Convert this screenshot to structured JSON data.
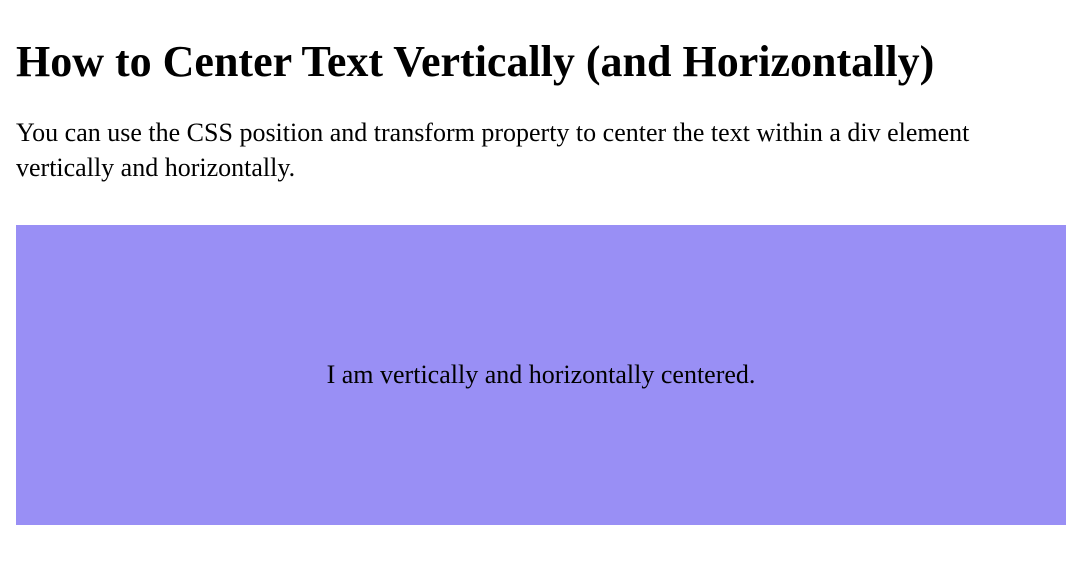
{
  "heading": "How to Center Text Vertically (and Horizontally)",
  "description": "You can use the CSS position and transform property to center the text within a div element vertically and horizontally.",
  "demo": {
    "centered_text": "I am vertically and horizontally centered."
  }
}
